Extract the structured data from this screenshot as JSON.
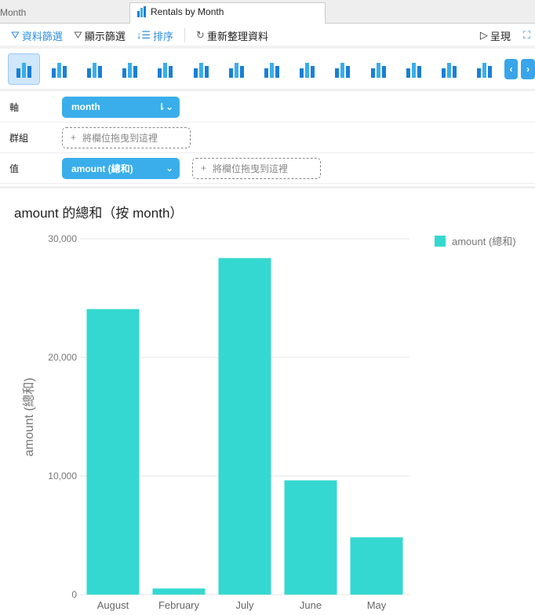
{
  "tabs": [
    {
      "label": "Month"
    },
    {
      "label": "Rentals by Month",
      "icon": "bar-chart-icon"
    }
  ],
  "toolbar": {
    "data_filter": "資料篩選",
    "display_filter": "顯示篩選",
    "sort": "排序",
    "refresh": "重新整理資料",
    "present": "呈現"
  },
  "chart_types": [
    "clustered-column",
    "stacked-column",
    "clustered-bar",
    "stacked-bar",
    "line",
    "area",
    "stacked-area",
    "column-line",
    "stacked-column-line",
    "waterfall",
    "funnel",
    "pie",
    "doughnut",
    "scatter"
  ],
  "fields": {
    "axis_label": "軸",
    "axis_field": "month",
    "group_label": "群組",
    "drop_placeholder": "將欄位拖曳到這裡",
    "value_label": "值",
    "value_field": "amount (總和)"
  },
  "chart_data": {
    "type": "bar",
    "title": "amount 的總和（按 month）",
    "ylabel": "amount (總和)",
    "xlabel": "",
    "categories": [
      "August",
      "February",
      "July",
      "June",
      "May"
    ],
    "series": [
      {
        "name": "amount (總和)",
        "values": [
          24072.13,
          514.18,
          28373.89,
          9631.88,
          4824.43
        ],
        "color": "#34d8d0"
      }
    ],
    "ylim": [
      0,
      30000
    ],
    "yticks": [
      "0",
      "10,000",
      "20,000",
      "30,000"
    ],
    "grid": true,
    "legend": "top-right"
  },
  "colors": {
    "accent": "#3aaeea",
    "bar": "#34d8d0"
  }
}
